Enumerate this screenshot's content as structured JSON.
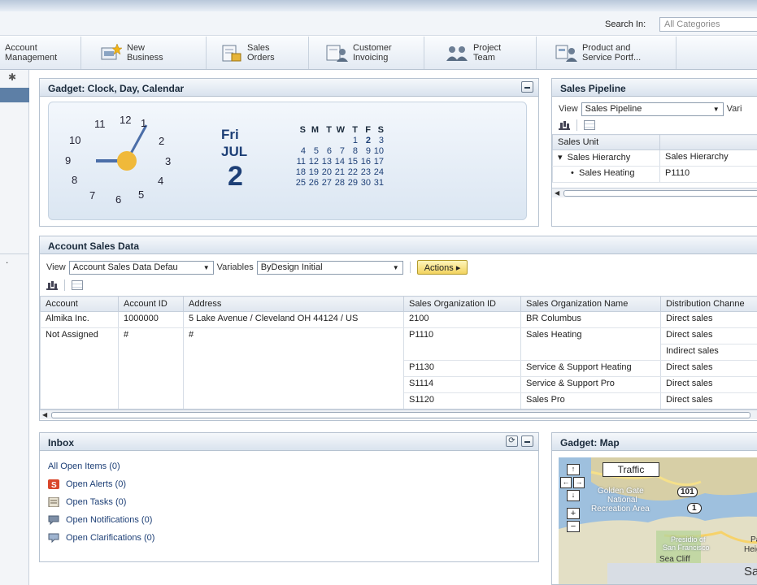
{
  "search": {
    "label": "Search In:",
    "placeholder": "All Categories"
  },
  "nav": [
    {
      "label": "Account\nManagement"
    },
    {
      "label": "New\nBusiness"
    },
    {
      "label": "Sales\nOrders"
    },
    {
      "label": "Customer\nInvoicing"
    },
    {
      "label": "Project\nTeam"
    },
    {
      "label": "Product and\nService Portf..."
    }
  ],
  "clock_gadget": {
    "title": "Gadget: Clock, Day, Calendar",
    "numbers": [
      "12",
      "1",
      "2",
      "3",
      "4",
      "5",
      "6",
      "7",
      "8",
      "9",
      "10",
      "11"
    ],
    "day": "Fri",
    "month": "JUL",
    "date": "2",
    "weekdays": [
      "S",
      "M",
      "T",
      "W",
      "T",
      "F",
      "S"
    ],
    "weeks": [
      [
        "",
        "",
        "",
        "",
        "1",
        "2",
        "3"
      ],
      [
        "4",
        "5",
        "6",
        "7",
        "8",
        "9",
        "10"
      ],
      [
        "11",
        "12",
        "13",
        "14",
        "15",
        "16",
        "17"
      ],
      [
        "18",
        "19",
        "20",
        "21",
        "22",
        "23",
        "24"
      ],
      [
        "25",
        "26",
        "27",
        "28",
        "29",
        "30",
        "31"
      ]
    ]
  },
  "sales_pipeline": {
    "title": "Sales Pipeline",
    "view_label": "View",
    "view_value": "Sales Pipeline",
    "variables_label": "Vari",
    "columns": [
      "Sales Unit",
      ""
    ],
    "rows": [
      {
        "tree": "▾",
        "unit": "Sales Hierarchy",
        "value": "Sales Hierarchy"
      },
      {
        "tree": "•",
        "unit": "Sales Heating",
        "value": "P1110"
      }
    ]
  },
  "account_sales": {
    "title": "Account Sales Data",
    "view_label": "View",
    "view_value": "Account Sales Data Defau",
    "variables_label": "Variables",
    "variables_value": "ByDesign Initial",
    "actions_label": "Actions",
    "columns": [
      "Account",
      "Account ID",
      "Address",
      "Sales Organization ID",
      "Sales Organization Name",
      "Distribution Channe"
    ],
    "rows": [
      [
        "Almika Inc.",
        "1000000",
        "5 Lake Avenue / Cleveland OH 44124 / US",
        "2100",
        "BR Columbus",
        "Direct sales"
      ],
      [
        "Not Assigned",
        "#",
        "#",
        "P1110",
        "Sales Heating",
        "Direct sales"
      ],
      [
        "",
        "",
        "",
        "",
        "",
        "Indirect sales"
      ],
      [
        "",
        "",
        "",
        "P1130",
        "Service & Support Heating",
        "Direct sales"
      ],
      [
        "",
        "",
        "",
        "S1114",
        "Service & Support Pro",
        "Direct sales"
      ],
      [
        "",
        "",
        "",
        "S1120",
        "Sales Pro",
        "Direct sales"
      ]
    ]
  },
  "inbox": {
    "title": "Inbox",
    "items": [
      "All Open Items (0)",
      "Open Alerts (0)",
      "Open Tasks (0)",
      "Open Notifications (0)",
      "Open Clarifications (0)"
    ]
  },
  "map_gadget": {
    "title": "Gadget: Map",
    "traffic_label": "Traffic",
    "labels": [
      "Golden Gate",
      "National",
      "Recreation Area",
      "101",
      "1",
      "Presidio of",
      "San Francisco",
      "Pacif",
      "Heigh",
      "Sea Cliff",
      "Sa"
    ]
  }
}
